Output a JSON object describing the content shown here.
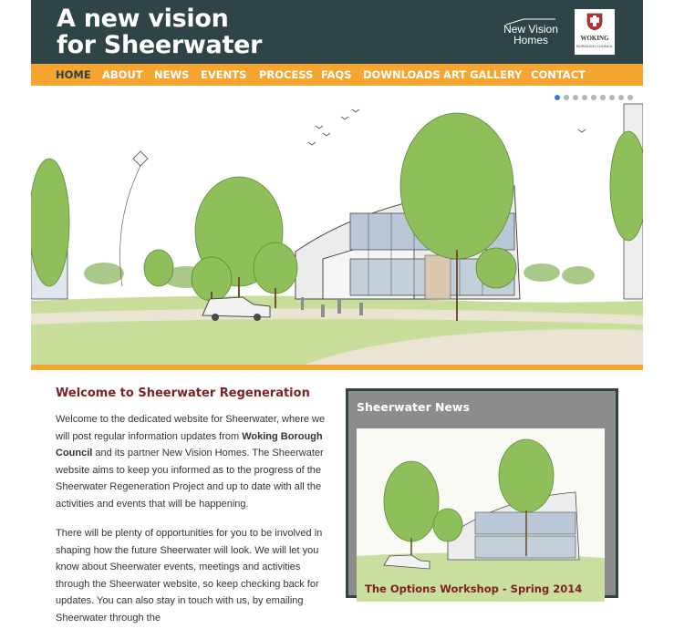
{
  "header": {
    "title_line1": "A new vision",
    "title_line2": "for Sheerwater",
    "partner_logo_line1": "New Vision",
    "partner_logo_line2": "Homes",
    "council_logo_line1": "WOKING",
    "council_logo_line2": "BOROUGH COUNCIL"
  },
  "nav": {
    "items": [
      {
        "label": "HOME",
        "active": true
      },
      {
        "label": "ABOUT"
      },
      {
        "label": "NEWS"
      },
      {
        "label": "EVENTS"
      },
      {
        "label": "PROCESS"
      },
      {
        "label": "FAQS"
      },
      {
        "label": "DOWNLOADS"
      },
      {
        "label": "ART GALLERY"
      },
      {
        "label": "CONTACT"
      }
    ]
  },
  "slider": {
    "slide_count": 9,
    "active_slide": 1
  },
  "welcome": {
    "title": "Welcome to Sheerwater Regeneration",
    "p1_a": "Welcome to the dedicated website for Sheerwater, where we will post regular information updates from ",
    "p1_bold": "Woking Borough Council",
    "p1_b": " and its partner New Vision Homes. The Sheerwater website aims to keep you informed as to the progress of the Sheerwater Regeneration Project and up to date with all the activities and events that will be happening.",
    "p2": "There will be plenty of opportunities for you to be involved in shaping how the future Sheerwater will look. We will let you know about Sheerwater events, meetings and activities through the Sheerwater website, so keep checking back for updates. You can also stay in touch with us, by emailing Sheerwater through the"
  },
  "news": {
    "title": "Sheerwater News",
    "caption": "The Options Workshop - Spring 2014"
  },
  "colors": {
    "header_bg": "#2e4446",
    "nav_bg": "#f5a530",
    "heading_red": "#7d2222",
    "active_dot": "#3a7fc4"
  }
}
